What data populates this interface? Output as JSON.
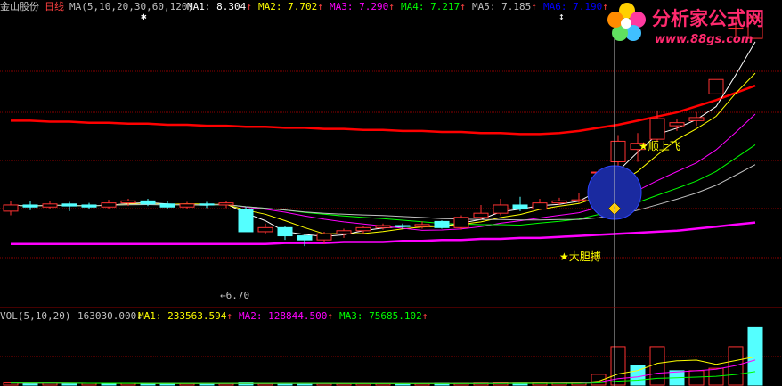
{
  "header": {
    "stock_name": "金山股份",
    "period": "日线",
    "ma_params": "MA(5,10,20,30,60,120)",
    "items": [
      {
        "label": "MA1: 8.304",
        "arrow": "↑",
        "color": "#ffffff"
      },
      {
        "label": "MA2: 7.702",
        "arrow": "↑",
        "color": "#ffff00"
      },
      {
        "label": "MA3: 7.290",
        "arrow": "↑",
        "color": "#ff00ff"
      },
      {
        "label": "MA4: 7.217",
        "arrow": "↑",
        "color": "#00ff00"
      },
      {
        "label": "MA5: 7.185",
        "arrow": "↑",
        "color": "#c0c0c0"
      },
      {
        "label": "MA6: 7.190",
        "arrow": "↑",
        "color": "#0000ff"
      }
    ]
  },
  "volume_header": {
    "params": "VOL(5,10,20)",
    "vol_value": "163030.000",
    "vol_arrow": "↓",
    "items": [
      {
        "label": "MA1: 233563.594",
        "arrow": "↑",
        "color": "#ffff00"
      },
      {
        "label": "MA2: 128844.500",
        "arrow": "↑",
        "color": "#ff00ff"
      },
      {
        "label": "MA3: 75685.102",
        "arrow": "↑",
        "color": "#00ff00"
      }
    ]
  },
  "watermark": {
    "text": "分析家公式网",
    "url": "www.88gs.com"
  },
  "annotations": {
    "low_label": "6.70",
    "label_1": "★顺上飞",
    "label_2": "★大胆搏"
  },
  "colors": {
    "up": "#ff3232",
    "down": "#54ffff",
    "ma1": "#ffffff",
    "ma2": "#ffff00",
    "ma3": "#ff00ff",
    "ma4": "#00ff00",
    "ma5": "#c0c0c0",
    "ma6": "#0000ff",
    "long_ma_red": "#ff0000",
    "long_ma_magenta": "#ff00ff",
    "highlight_circle": "#1a2aa0",
    "grid": "#8b0000"
  },
  "chart_data": {
    "type": "candlestick",
    "price_range": [
      6.2,
      9.0
    ],
    "candles": [
      {
        "o": 7.12,
        "c": 7.18,
        "h": 7.22,
        "l": 7.08
      },
      {
        "o": 7.18,
        "c": 7.16,
        "h": 7.22,
        "l": 7.13
      },
      {
        "o": 7.16,
        "c": 7.19,
        "h": 7.22,
        "l": 7.14
      },
      {
        "o": 7.19,
        "c": 7.17,
        "h": 7.21,
        "l": 7.12
      },
      {
        "o": 7.18,
        "c": 7.16,
        "h": 7.2,
        "l": 7.14
      },
      {
        "o": 7.16,
        "c": 7.2,
        "h": 7.23,
        "l": 7.14
      },
      {
        "o": 7.2,
        "c": 7.22,
        "h": 7.24,
        "l": 7.17
      },
      {
        "o": 7.22,
        "c": 7.19,
        "h": 7.24,
        "l": 7.17
      },
      {
        "o": 7.19,
        "c": 7.16,
        "h": 7.22,
        "l": 7.14
      },
      {
        "o": 7.16,
        "c": 7.19,
        "h": 7.21,
        "l": 7.14
      },
      {
        "o": 7.19,
        "c": 7.18,
        "h": 7.21,
        "l": 7.15
      },
      {
        "o": 7.18,
        "c": 7.2,
        "h": 7.22,
        "l": 7.15
      },
      {
        "o": 7.14,
        "c": 6.92,
        "h": 7.16,
        "l": 6.92
      },
      {
        "o": 6.92,
        "c": 6.96,
        "h": 7.0,
        "l": 6.9
      },
      {
        "o": 6.96,
        "c": 6.88,
        "h": 6.98,
        "l": 6.84
      },
      {
        "o": 6.88,
        "c": 6.84,
        "h": 6.9,
        "l": 6.78
      },
      {
        "o": 6.84,
        "c": 6.9,
        "h": 6.92,
        "l": 6.8
      },
      {
        "o": 6.9,
        "c": 6.93,
        "h": 6.95,
        "l": 6.86
      },
      {
        "o": 6.93,
        "c": 6.96,
        "h": 6.98,
        "l": 6.9
      },
      {
        "o": 6.96,
        "c": 6.98,
        "h": 7.0,
        "l": 6.94
      },
      {
        "o": 6.98,
        "c": 6.97,
        "h": 7.0,
        "l": 6.95
      },
      {
        "o": 6.97,
        "c": 6.99,
        "h": 7.02,
        "l": 6.95
      },
      {
        "o": 7.02,
        "c": 6.96,
        "h": 7.03,
        "l": 6.95
      },
      {
        "o": 6.96,
        "c": 7.06,
        "h": 7.08,
        "l": 6.94
      },
      {
        "o": 7.06,
        "c": 7.1,
        "h": 7.18,
        "l": 7.04
      },
      {
        "o": 7.1,
        "c": 7.18,
        "h": 7.24,
        "l": 7.08
      },
      {
        "o": 7.18,
        "c": 7.14,
        "h": 7.26,
        "l": 7.12
      },
      {
        "o": 7.14,
        "c": 7.2,
        "h": 7.24,
        "l": 7.13
      },
      {
        "o": 7.2,
        "c": 7.22,
        "h": 7.25,
        "l": 7.18
      },
      {
        "o": 7.22,
        "c": 7.23,
        "h": 7.3,
        "l": 7.2
      },
      {
        "o": 7.5,
        "c": 7.5,
        "h": 7.52,
        "l": 7.48
      },
      {
        "o": 7.6,
        "c": 7.8,
        "h": 7.86,
        "l": 7.55
      },
      {
        "o": 7.72,
        "c": 7.78,
        "h": 7.88,
        "l": 7.6
      },
      {
        "o": 7.82,
        "c": 8.02,
        "h": 8.1,
        "l": 7.8
      },
      {
        "o": 7.95,
        "c": 7.98,
        "h": 8.02,
        "l": 7.9
      },
      {
        "o": 8.0,
        "c": 8.03,
        "h": 8.08,
        "l": 7.95
      },
      {
        "o": 8.26,
        "c": 8.4,
        "h": 8.4,
        "l": 8.26
      },
      {
        "o": 8.9,
        "c": 8.9,
        "h": 9.0,
        "l": 8.8
      },
      {
        "o": 8.8,
        "c": 9.0,
        "h": 9.0,
        "l": 8.8
      }
    ],
    "volume_range": [
      0,
      260000
    ],
    "volumes": [
      {
        "v": 9000,
        "up": true
      },
      {
        "v": 7000,
        "up": false
      },
      {
        "v": 8000,
        "up": true
      },
      {
        "v": 6500,
        "up": false
      },
      {
        "v": 7000,
        "up": true
      },
      {
        "v": 6000,
        "up": false
      },
      {
        "v": 7500,
        "up": true
      },
      {
        "v": 6200,
        "up": false
      },
      {
        "v": 7000,
        "up": false
      },
      {
        "v": 6800,
        "up": true
      },
      {
        "v": 6000,
        "up": false
      },
      {
        "v": 6500,
        "up": true
      },
      {
        "v": 9000,
        "up": false
      },
      {
        "v": 6000,
        "up": true
      },
      {
        "v": 7000,
        "up": false
      },
      {
        "v": 6500,
        "up": false
      },
      {
        "v": 6000,
        "up": true
      },
      {
        "v": 5500,
        "up": true
      },
      {
        "v": 6000,
        "up": true
      },
      {
        "v": 6500,
        "up": true
      },
      {
        "v": 5800,
        "up": false
      },
      {
        "v": 6000,
        "up": true
      },
      {
        "v": 7500,
        "up": false
      },
      {
        "v": 7500,
        "up": true
      },
      {
        "v": 8500,
        "up": true
      },
      {
        "v": 9500,
        "up": true
      },
      {
        "v": 8000,
        "up": false
      },
      {
        "v": 9000,
        "up": true
      },
      {
        "v": 8500,
        "up": true
      },
      {
        "v": 9000,
        "up": true
      },
      {
        "v": 45000,
        "up": true
      },
      {
        "v": 160000,
        "up": true
      },
      {
        "v": 80000,
        "up": false
      },
      {
        "v": 160000,
        "up": true
      },
      {
        "v": 60000,
        "up": false
      },
      {
        "v": 60000,
        "up": true
      },
      {
        "v": 70000,
        "up": true
      },
      {
        "v": 160000,
        "up": true
      },
      {
        "v": 240000,
        "up": false
      }
    ]
  }
}
